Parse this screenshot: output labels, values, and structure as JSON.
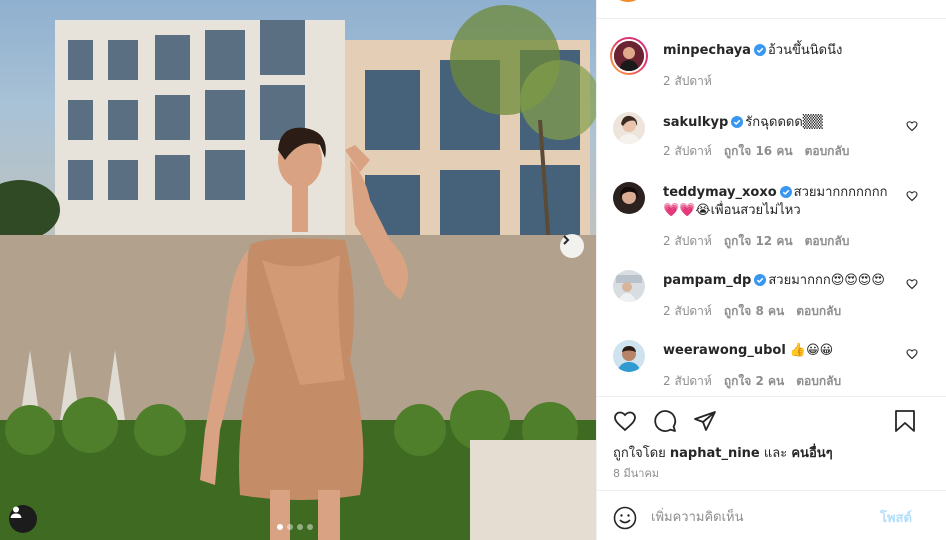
{
  "post": {
    "author": "minpechaya",
    "caption": "อ้วนขึ้นนิดนึง",
    "caption_time": "2 สัปดาห์"
  },
  "comments": [
    {
      "username": "sakulkyp",
      "verified": true,
      "text": "รักฉุดดดด▒▒",
      "time": "2 สัปดาห์",
      "likes": "ถูกใจ 16 คน",
      "reply": "ตอบกลับ"
    },
    {
      "username": "teddymay_xoxo",
      "verified": true,
      "text": "สวยมากกกกกกก 💗💗😭เพื่อนสวยไม่ไหว",
      "time": "2 สัปดาห์",
      "likes": "ถูกใจ 12 คน",
      "reply": "ตอบกลับ"
    },
    {
      "username": "pampam_dp",
      "verified": true,
      "text": "สวยมากกก😍😍😍😍",
      "time": "2 สัปดาห์",
      "likes": "ถูกใจ 8 คน",
      "reply": "ตอบกลับ"
    },
    {
      "username": "weerawong_ubol",
      "verified": false,
      "text": "👍😀😀",
      "time": "2 สัปดาห์",
      "likes": "ถูกใจ 2 คน",
      "reply": "ตอบกลับ"
    }
  ],
  "likes_line": {
    "prefix": "ถูกใจโดย",
    "user": "naphat_nine",
    "and": "และ",
    "others": "คนอื่นๆ"
  },
  "post_date": "8 มีนาคม",
  "comment_box": {
    "placeholder": "เพิ่มความคิดเห็น",
    "post_label": "โพสต์"
  },
  "carousel": {
    "count": 4,
    "active": 1
  },
  "colors": {
    "accent": "#0095f6",
    "post_disabled": "#b2dffc",
    "muted": "#8e8e8e",
    "verified": "#3897f0"
  }
}
